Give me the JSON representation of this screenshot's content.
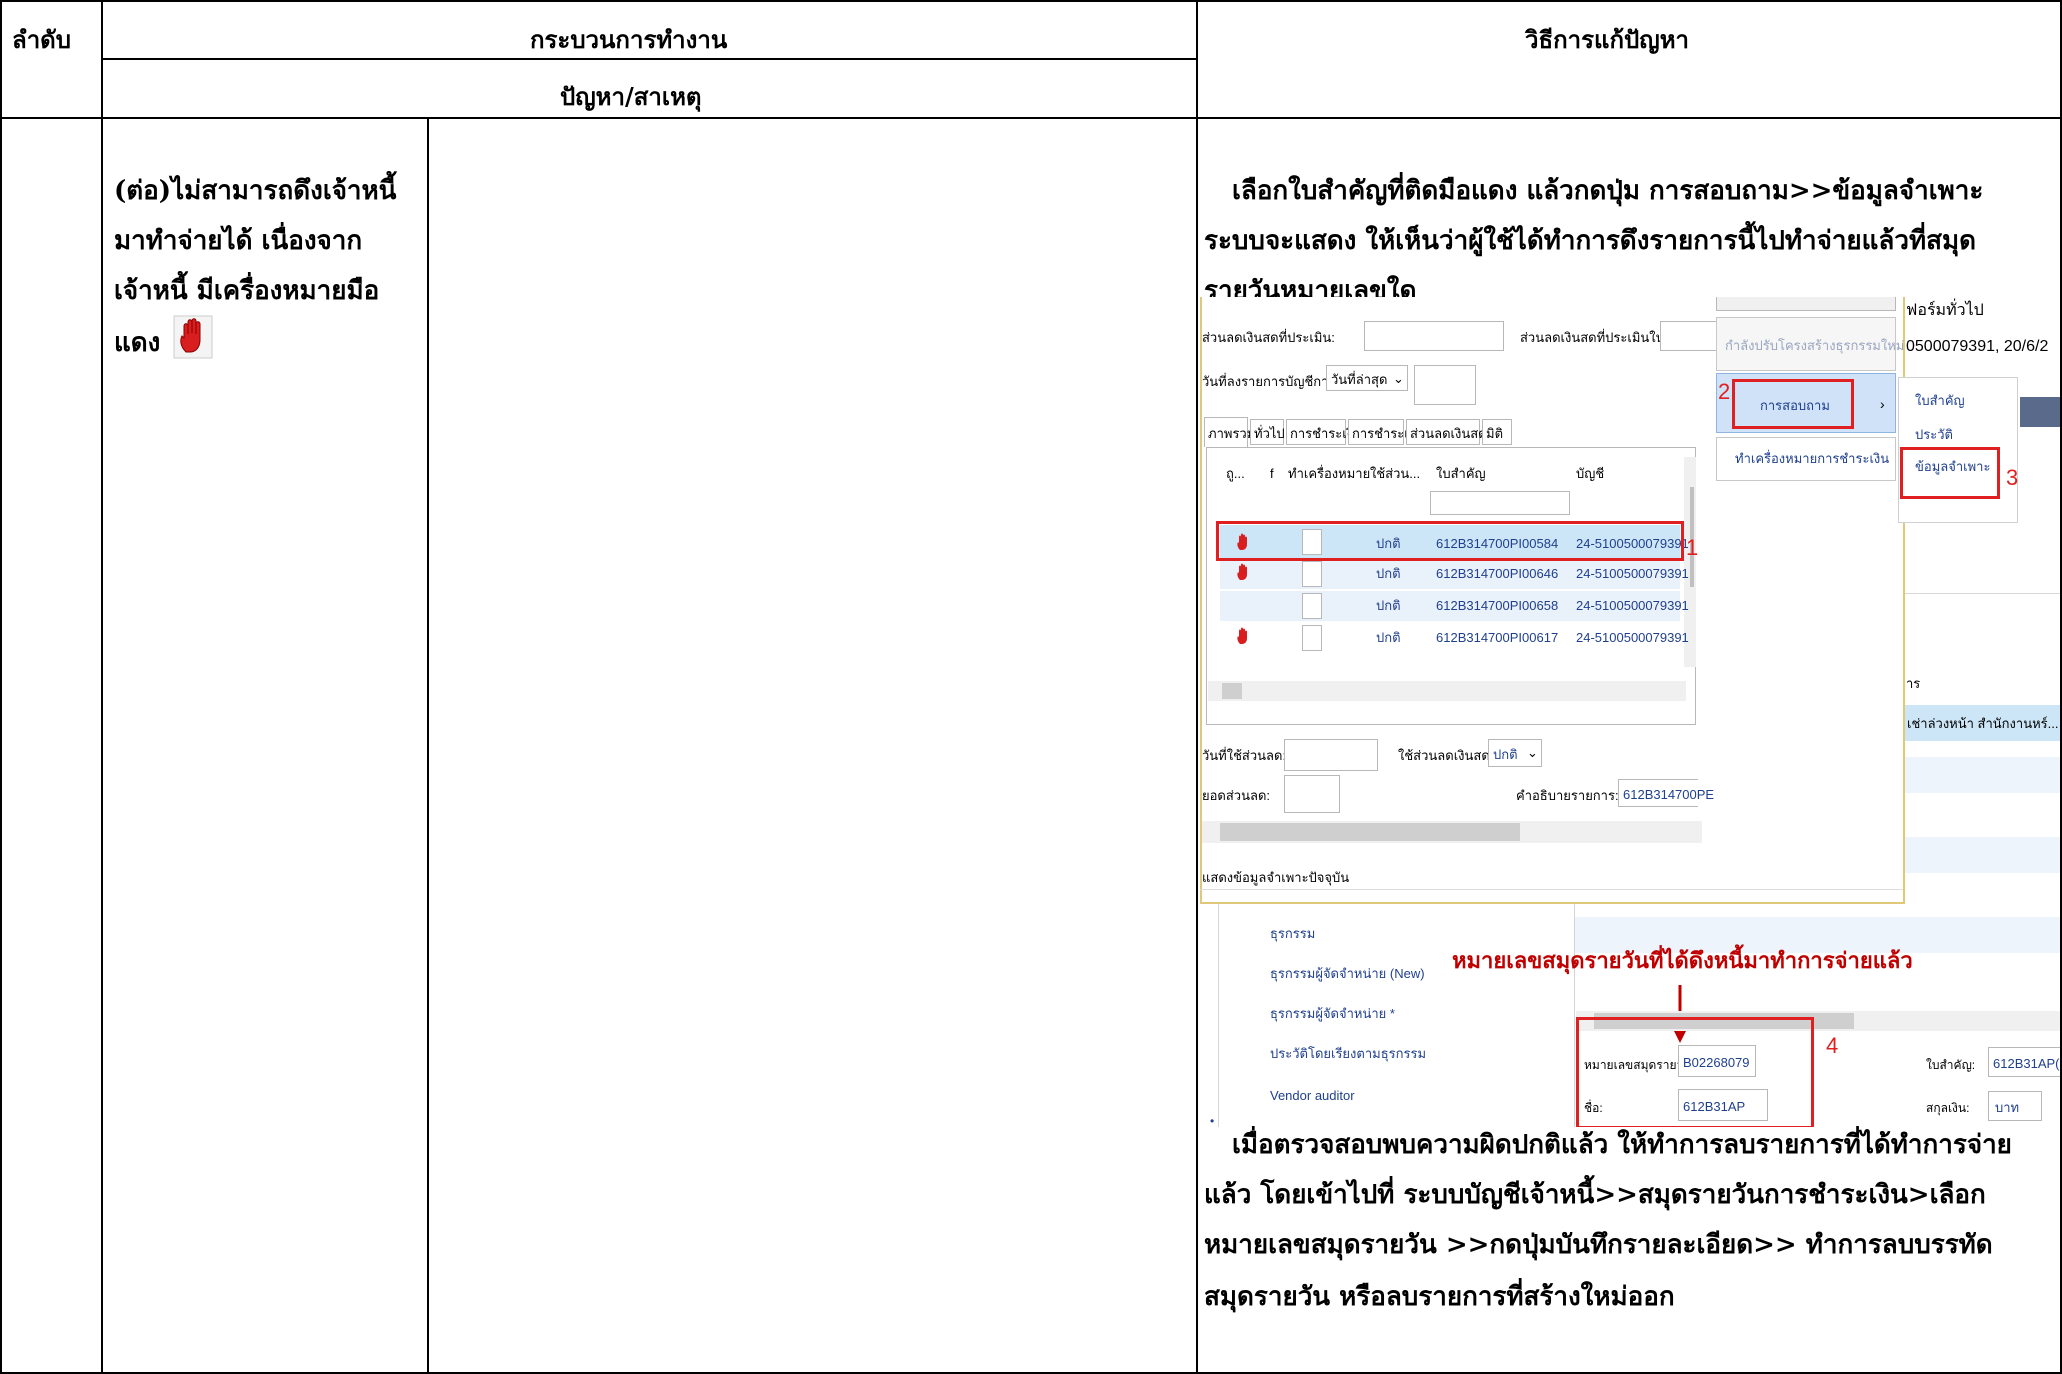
{
  "table": {
    "col_order": "ลำดับ",
    "col_process": "กระบวนการทำงาน",
    "col_solution": "วิธีการแก้ปัญหา",
    "sub_problem": "ปัญหา/สาเหตุ",
    "problem_lines": [
      "(ต่อ)ไม่สามารถดึงเจ้าหนี้",
      "มาทำจ่ายได้ เนื่องจาก",
      "เจ้าหนี้ มีเครื่องหมายมือ",
      "แดง"
    ],
    "solution_lines_top": [
      "เลือกใบสำคัญที่ติดมือแดง แล้วกดปุ่ม การสอบถาม>>ข้อมูลจำเพาะ",
      "ระบบจะแสดง ให้เห็นว่าผู้ใช้ได้ทำการดึงรายการนี้ไปทำจ่ายแล้วที่สมุด",
      "รายวันหมายเลขใด"
    ],
    "solution_lines_bottom": [
      "เมื่อตรวจสอบพบความผิดปกติแล้ว ให้ทำการลบรายการที่ได้ทำการจ่าย",
      "แล้ว โดยเข้าไปที่ ระบบบัญชีเจ้าหนี้>>สมุดรายวันการชำระเงิน>เลือก",
      "หมายเลขสมุดรายวัน >>กดปุ่มบันทึกรายละเอียด>> ทำการลบบรรทัด",
      "สมุดรายวัน หรือลบรายการที่สร้างใหม่ออก"
    ]
  },
  "screenshot": {
    "label_discount_amount": "ส่วนลดเงินสดที่ประเมิน:",
    "label_discount_amount_baht": "ส่วนลดเงินสดที่ประเมินใน บาท:",
    "label_posting_date": "วันที่ลงรายการบัญชีการชำระบัญชี:",
    "posting_date_value": "วันที่ล่าสุด",
    "btn_rebuild": "กำลังปรับโครงสร้างธุรกรรมใหม่",
    "btn_inquiry": "การสอบถาม",
    "btn_mark_payment": "ทำเครื่องหมายการชำระเงิน",
    "tabs": [
      "ภาพรวม",
      "ทั่วไป",
      "การชำระเงิน",
      "การชำระเงิน",
      "ส่วนลดเงินสด",
      "มิติ"
    ],
    "grid_headers": [
      "ถู...",
      "f",
      "ทำเครื่องหมาย",
      "ใช้ส่วน...",
      "ใบสำคัญ",
      "บัญชี"
    ],
    "rows": [
      {
        "hand": true,
        "status": "ปกติ",
        "voucher": "612B314700PI00584",
        "account": "24-5100500079391"
      },
      {
        "hand": true,
        "status": "ปกติ",
        "voucher": "612B314700PI00646",
        "account": "24-5100500079391"
      },
      {
        "hand": false,
        "status": "ปกติ",
        "voucher": "612B314700PI00658",
        "account": "24-5100500079391"
      },
      {
        "hand": true,
        "status": "ปกติ",
        "voucher": "612B314700PI00617",
        "account": "24-5100500079391"
      }
    ],
    "label_discount_date": "วันที่ใช้ส่วนลด:",
    "label_use_discount": "ใช้ส่วนลดเงินสด:",
    "use_discount_value": "ปกติ",
    "label_discount_total": "ยอดส่วนลด:",
    "label_description": "คำอธิบายรายการ:",
    "description_value": "612B314700PE",
    "status_bar": "แสดงข้อมูลจำเพาะปัจจุบัน",
    "form_title": "ฟอร์มทั่วไป",
    "form_subtitle": "0500079391, 20/6/2",
    "menu_items": [
      "ใบสำคัญ",
      "ประวัติ",
      "ข้อมูลจำเพาะ"
    ],
    "right_col_header": "าร",
    "right_col_value": "เช่าล่วงหน้า สำนักงานหร์...",
    "nav_items": [
      "ธุรกรรม",
      "ธุรกรรมผู้จัดจำหน่าย (New)",
      "ธุรกรรมผู้จัดจำหน่าย *",
      "ประวัติโดยเรียงตามธุรกรรม",
      "Vendor auditor"
    ],
    "annotation": "หมายเลขสมุดรายวันที่ได้ดึงหนี้มาทำการจ่ายแล้ว",
    "label_journal_no": "หมายเลขสมุดรายวัน:",
    "journal_no_value": "B02268079",
    "label_name": "ชื่อ:",
    "name_value": "612B31AP",
    "label_voucher": "ใบสำคัญ:",
    "voucher_value": "612B31AP(",
    "label_currency": "สกุลเงิน:",
    "currency_value": "บาท",
    "step_numbers": [
      "1",
      "2",
      "3",
      "4"
    ],
    "colors": {
      "highlight_row": "#cde6f7",
      "red": "#e02020",
      "annotation": "#c00000"
    }
  }
}
